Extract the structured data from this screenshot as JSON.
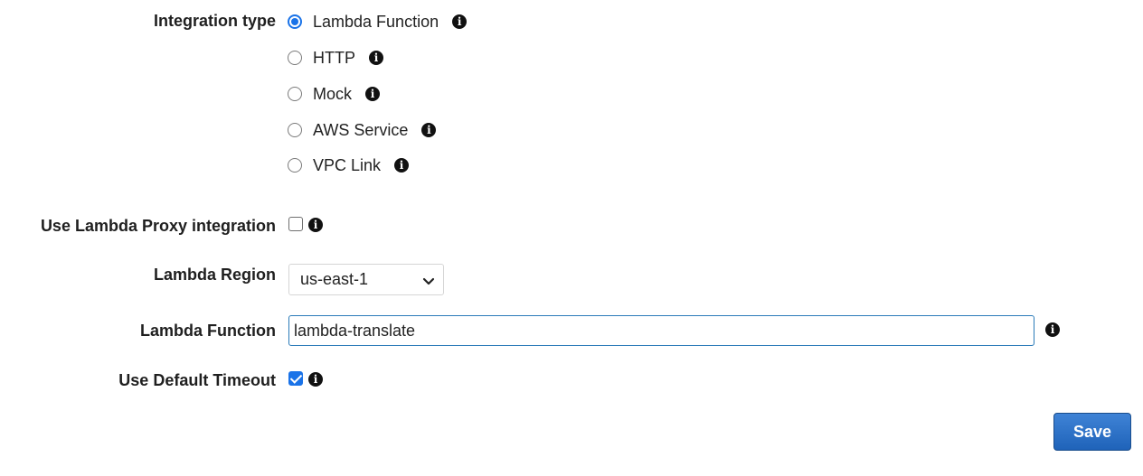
{
  "integration_type": {
    "label": "Integration type",
    "options": [
      {
        "label": "Lambda Function",
        "selected": true
      },
      {
        "label": "HTTP",
        "selected": false
      },
      {
        "label": "Mock",
        "selected": false
      },
      {
        "label": "AWS Service",
        "selected": false
      },
      {
        "label": "VPC Link",
        "selected": false
      }
    ]
  },
  "proxy": {
    "label": "Use Lambda Proxy integration",
    "checked": false
  },
  "region": {
    "label": "Lambda Region",
    "value": "us-east-1"
  },
  "function": {
    "label": "Lambda Function",
    "value": "lambda-translate"
  },
  "timeout": {
    "label": "Use Default Timeout",
    "checked": true
  },
  "actions": {
    "save_label": "Save"
  },
  "icons": {
    "info": "info-icon",
    "chevron": "chevron-down-icon"
  },
  "colors": {
    "accent": "#1a73e8",
    "save_button": "#2a6fc9"
  }
}
